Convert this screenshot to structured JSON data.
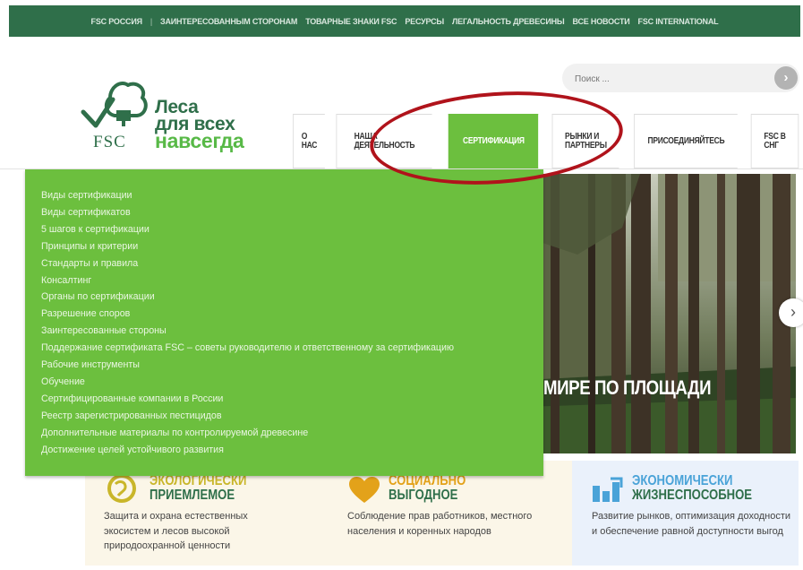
{
  "topbar": {
    "brand": "FSC РОССИЯ",
    "separator": "|",
    "links": [
      "ЗАИНТЕРЕСОВАННЫМ СТОРОНАМ",
      "ТОВАРНЫЕ ЗНАКИ FSC",
      "РЕСУРСЫ",
      "ЛЕГАЛЬНОСТЬ ДРЕВЕСИНЫ",
      "ВСЕ НОВОСТИ",
      "FSC INTERNATIONAL"
    ]
  },
  "search": {
    "placeholder": "Поиск ...",
    "button_icon": "chevron-right-icon",
    "button_glyph": "›"
  },
  "logo": {
    "line1": "Леса",
    "line2": "для всех",
    "line3": "навсегда",
    "mark": "FSC"
  },
  "nav": {
    "items": [
      {
        "line1": "О",
        "line2": "НАС"
      },
      {
        "line1": "НАША",
        "line2": "ДЕЯТЕЛЬНОСТЬ"
      },
      {
        "line1": "СЕРТИФИКАЦИЯ",
        "line2": ""
      },
      {
        "line1": "РЫНКИ И",
        "line2": "ПАРТНЕРЫ"
      },
      {
        "line1": "ПРИСОЕДИНЯЙТЕСЬ",
        "line2": ""
      },
      {
        "line1": "FSC В",
        "line2": "СНГ"
      }
    ],
    "active_color": "#6cbf3e"
  },
  "dropdown": {
    "items": [
      "Виды сертификации",
      "Виды сертификатов",
      "5 шагов к сертификации",
      "Принципы и критерии",
      "Стандарты и правила",
      "Консалтинг",
      "Органы по сертификации",
      "Разрешение споров",
      "Заинтересованные стороны",
      "Поддержание сертификата FSC – советы руководителю и ответственному за сертификацию",
      "Рабочие инструменты",
      "Обучение",
      "Сертифицированные компании в России",
      "Реестр зарегистрированных пестицидов",
      "Дополнительные материалы по контролируемой древесине",
      "Достижение целей устойчивого развития"
    ]
  },
  "hero": {
    "title": "МИРЕ ПО ПЛОЩАДИ",
    "next_glyph": "›"
  },
  "cards": [
    {
      "title1": "ЭКОЛОГИЧЕСКИ",
      "title2": "ПРИЕМЛЕМОЕ",
      "desc": "Защита и охрана естественных экосистем и лесов высокой природоохранной ценности",
      "icon": "globe-leaf-icon",
      "accent": "#c9b62a",
      "bg": "#fbf6e8"
    },
    {
      "title1": "СОЦИАЛЬНО",
      "title2": "ВЫГОДНОЕ",
      "desc": "Соблюдение прав работников, местного населения и коренных народов",
      "icon": "heart-icon",
      "accent": "#e3a21a",
      "bg": "#fbf6e8"
    },
    {
      "title1": "ЭКОНОМИЧЕСКИ",
      "title2": "ЖИЗНЕСПОСОБНОЕ",
      "desc": "Развитие рынков, оптимизация доходности и обеспечение равной доступности выгод",
      "icon": "bar-chart-icon",
      "accent": "#4aa3d8",
      "bg": "#eaf1fb"
    }
  ],
  "colors": {
    "brand_dark": "#2f6f4a",
    "brand_green": "#6cbf3e",
    "annotation": "#b0131b"
  }
}
